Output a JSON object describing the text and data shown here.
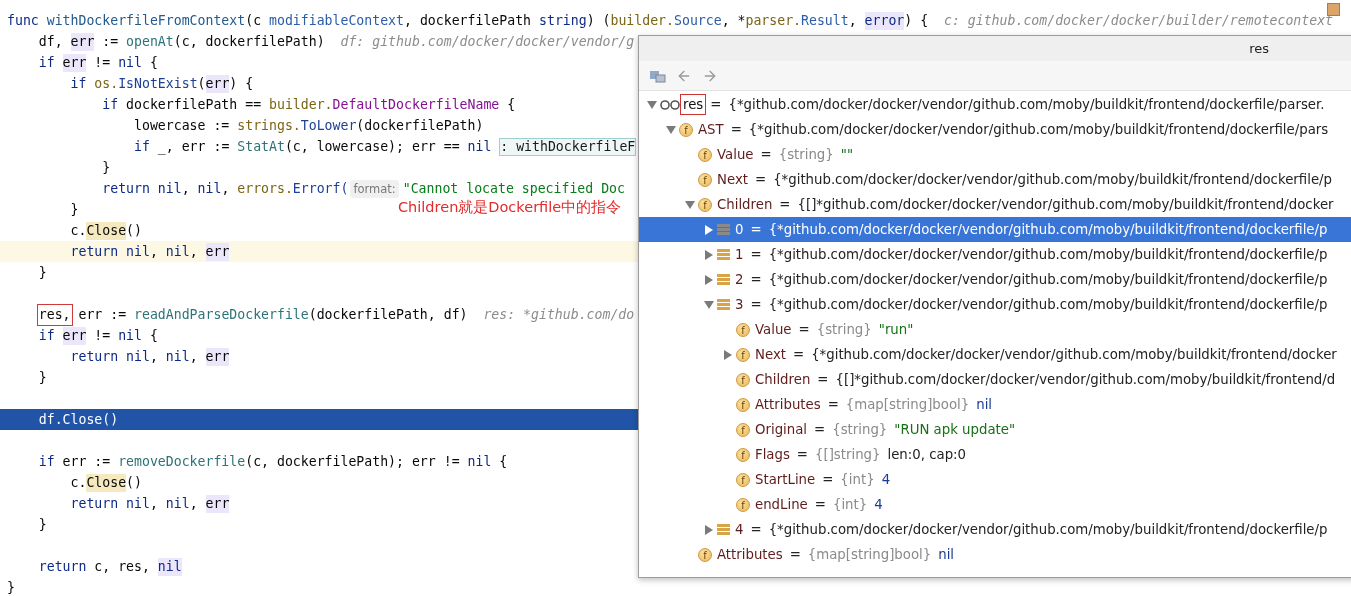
{
  "editor": {
    "lines": [
      {
        "selected": false,
        "caret": false,
        "tokens": [
          {
            "kind": "kw",
            "text": "func "
          },
          {
            "kind": "decl",
            "text": "withDockerfileFromContext"
          },
          {
            "kind": "plain",
            "text": "(c "
          },
          {
            "kind": "type",
            "text": "modifiableContext"
          },
          {
            "kind": "plain",
            "text": ", dockerfilePath "
          },
          {
            "kind": "kw",
            "text": "string"
          },
          {
            "kind": "plain",
            "text": ") ("
          },
          {
            "kind": "pkg",
            "text": "builder."
          },
          {
            "kind": "type",
            "text": "Source"
          },
          {
            "kind": "plain",
            "text": ", *"
          },
          {
            "kind": "pkg",
            "text": "parser."
          },
          {
            "kind": "type",
            "text": "Result"
          },
          {
            "kind": "plain",
            "text": ", "
          },
          {
            "kind": "refkw",
            "text": "error"
          },
          {
            "kind": "plain",
            "text": ") {"
          },
          {
            "kind": "hint",
            "text": "c: github.com/docker/docker/builder/remotecontext"
          }
        ]
      },
      {
        "selected": false,
        "caret": false,
        "tokens": [
          {
            "kind": "plain",
            "text": "    df, "
          },
          {
            "kind": "ref",
            "text": "err"
          },
          {
            "kind": "plain",
            "text": " := "
          },
          {
            "kind": "call",
            "text": "openAt"
          },
          {
            "kind": "plain",
            "text": "(c, dockerfilePath)"
          },
          {
            "kind": "hint",
            "text": "df: github.com/docker/docker/vendor/g"
          }
        ]
      },
      {
        "selected": false,
        "caret": false,
        "tokens": [
          {
            "kind": "kw",
            "text": "    if "
          },
          {
            "kind": "ref",
            "text": "err"
          },
          {
            "kind": "plain",
            "text": " != "
          },
          {
            "kind": "kw",
            "text": "nil"
          },
          {
            "kind": "plain",
            "text": " {"
          }
        ]
      },
      {
        "selected": false,
        "caret": false,
        "tokens": [
          {
            "kind": "kw",
            "text": "        if "
          },
          {
            "kind": "pkg",
            "text": "os."
          },
          {
            "kind": "method",
            "text": "IsNotExist"
          },
          {
            "kind": "plain",
            "text": "("
          },
          {
            "kind": "ref",
            "text": "err"
          },
          {
            "kind": "plain",
            "text": ") {"
          }
        ]
      },
      {
        "selected": false,
        "caret": false,
        "tokens": [
          {
            "kind": "kw",
            "text": "            if "
          },
          {
            "kind": "plain",
            "text": "dockerfilePath == "
          },
          {
            "kind": "pkg",
            "text": "builder."
          },
          {
            "kind": "const",
            "text": "DefaultDockerfileName"
          },
          {
            "kind": "plain",
            "text": " {"
          }
        ]
      },
      {
        "selected": false,
        "caret": false,
        "tokens": [
          {
            "kind": "plain",
            "text": "                lowercase := "
          },
          {
            "kind": "pkg",
            "text": "strings."
          },
          {
            "kind": "method",
            "text": "ToLower"
          },
          {
            "kind": "plain",
            "text": "(dockerfilePath)"
          }
        ]
      },
      {
        "selected": false,
        "caret": false,
        "tokens": [
          {
            "kind": "kw",
            "text": "                if "
          },
          {
            "kind": "plain",
            "text": "_, err := "
          },
          {
            "kind": "call",
            "text": "StatAt"
          },
          {
            "kind": "plain",
            "text": "(c, lowercase); err == "
          },
          {
            "kind": "kw",
            "text": "nil"
          },
          {
            "kind": "valuebox",
            "text": ": withDockerfileF"
          }
        ]
      },
      {
        "selected": false,
        "caret": false,
        "tokens": [
          {
            "kind": "plain",
            "text": "            }"
          }
        ]
      },
      {
        "selected": false,
        "caret": false,
        "tokens": [
          {
            "kind": "kw",
            "text": "            return "
          },
          {
            "kind": "kw",
            "text": "nil"
          },
          {
            "kind": "plain",
            "text": ", "
          },
          {
            "kind": "kw",
            "text": "nil"
          },
          {
            "kind": "plain",
            "text": ", "
          },
          {
            "kind": "pkg",
            "text": "errors."
          },
          {
            "kind": "method",
            "text": "Errorf("
          },
          {
            "kind": "inlay",
            "text": "format:"
          },
          {
            "kind": "str",
            "text": "\"Cannot locate specified Doc"
          }
        ]
      },
      {
        "selected": false,
        "caret": false,
        "tokens": [
          {
            "kind": "plain",
            "text": "        }"
          }
        ]
      },
      {
        "selected": false,
        "caret": false,
        "tokens": [
          {
            "kind": "plain",
            "text": "        c."
          },
          {
            "kind": "usage",
            "text": "Close"
          },
          {
            "kind": "plain",
            "text": "()"
          }
        ]
      },
      {
        "selected": false,
        "caret": true,
        "tokens": [
          {
            "kind": "kw",
            "text": "        return "
          },
          {
            "kind": "kw",
            "text": "nil"
          },
          {
            "kind": "plain",
            "text": ", "
          },
          {
            "kind": "kw",
            "text": "nil"
          },
          {
            "kind": "plain",
            "text": ", "
          },
          {
            "kind": "ref",
            "text": "err"
          }
        ]
      },
      {
        "selected": false,
        "caret": false,
        "tokens": [
          {
            "kind": "plain",
            "text": "    }"
          }
        ]
      },
      {
        "selected": false,
        "caret": false
      },
      {
        "selected": false,
        "caret": false,
        "tokens": [
          {
            "kind": "boxed",
            "text": "    res,"
          },
          {
            "kind": "plain",
            "text": " err := "
          },
          {
            "kind": "call",
            "text": "readAndParseDockerfile"
          },
          {
            "kind": "plain",
            "text": "(dockerfilePath, df)"
          },
          {
            "kind": "hint",
            "text": "res: *github.com/do"
          }
        ]
      },
      {
        "selected": false,
        "caret": false,
        "tokens": [
          {
            "kind": "kw",
            "text": "    if "
          },
          {
            "kind": "ref",
            "text": "err"
          },
          {
            "kind": "plain",
            "text": " != "
          },
          {
            "kind": "kw",
            "text": "nil"
          },
          {
            "kind": "plain",
            "text": " {"
          }
        ]
      },
      {
        "selected": false,
        "caret": false,
        "tokens": [
          {
            "kind": "kw",
            "text": "        return "
          },
          {
            "kind": "kw",
            "text": "nil"
          },
          {
            "kind": "plain",
            "text": ", "
          },
          {
            "kind": "kw",
            "text": "nil"
          },
          {
            "kind": "plain",
            "text": ", "
          },
          {
            "kind": "ref",
            "text": "err"
          }
        ]
      },
      {
        "selected": false,
        "caret": false,
        "tokens": [
          {
            "kind": "plain",
            "text": "    }"
          }
        ]
      },
      {
        "selected": false,
        "caret": false
      },
      {
        "selected": true,
        "caret": false,
        "tokens": [
          {
            "kind": "plain",
            "text": "    df.Close()"
          }
        ]
      },
      {
        "selected": false,
        "caret": false
      },
      {
        "selected": false,
        "caret": false,
        "tokens": [
          {
            "kind": "kw",
            "text": "    if "
          },
          {
            "kind": "plain",
            "text": "err := "
          },
          {
            "kind": "call",
            "text": "removeDockerfile"
          },
          {
            "kind": "plain",
            "text": "(c, dockerfilePath); err != "
          },
          {
            "kind": "kw",
            "text": "nil"
          },
          {
            "kind": "plain",
            "text": " {"
          }
        ]
      },
      {
        "selected": false,
        "caret": false,
        "tokens": [
          {
            "kind": "plain",
            "text": "        c."
          },
          {
            "kind": "usage",
            "text": "Close"
          },
          {
            "kind": "plain",
            "text": "()"
          }
        ]
      },
      {
        "selected": false,
        "caret": false,
        "tokens": [
          {
            "kind": "kw",
            "text": "        return "
          },
          {
            "kind": "kw",
            "text": "nil"
          },
          {
            "kind": "plain",
            "text": ", "
          },
          {
            "kind": "kw",
            "text": "nil"
          },
          {
            "kind": "plain",
            "text": ", "
          },
          {
            "kind": "ref",
            "text": "err"
          }
        ]
      },
      {
        "selected": false,
        "caret": false,
        "tokens": [
          {
            "kind": "plain",
            "text": "    }"
          }
        ]
      },
      {
        "selected": false,
        "caret": false
      },
      {
        "selected": false,
        "caret": false,
        "tokens": [
          {
            "kind": "kw",
            "text": "    return "
          },
          {
            "kind": "plain",
            "text": "c, res, "
          },
          {
            "kind": "refkw",
            "text": "nil"
          }
        ]
      },
      {
        "selected": false,
        "caret": false,
        "tokens": [
          {
            "kind": "plain",
            "text": "}"
          }
        ]
      }
    ]
  },
  "annotation": {
    "text": "Children就是Dockerfile中的指令"
  },
  "popup": {
    "title": "res",
    "tree": [
      {
        "kind": "watch",
        "name": "res",
        "boxed": true,
        "op": "=",
        "value": "{*github.com/docker/docker/vendor/github.com/moby/buildkit/frontend/dockerfile/parser.",
        "expanded": true,
        "selected": false,
        "children": [
          {
            "kind": "field",
            "badge": "f",
            "name": "AST",
            "op": "=",
            "value": "{*github.com/docker/docker/vendor/github.com/moby/buildkit/frontend/dockerfile/pars",
            "expanded": true,
            "selected": false,
            "children": [
              {
                "kind": "field",
                "badge": "f",
                "name": "Value",
                "op": "=",
                "type": "{string}",
                "string_value": "\"\"",
                "selected": false
              },
              {
                "kind": "field",
                "badge": "f",
                "name": "Next",
                "op": "=",
                "value": "{*github.com/docker/docker/vendor/github.com/moby/buildkit/frontend/dockerfile/p",
                "selected": false
              },
              {
                "kind": "field",
                "badge": "f",
                "name": "Children",
                "op": "=",
                "value": "{[]*github.com/docker/docker/vendor/github.com/moby/buildkit/frontend/docker",
                "expanded": true,
                "selected": false,
                "children": [
                  {
                    "kind": "element",
                    "name": "0",
                    "op": "=",
                    "value": "{*github.com/docker/docker/vendor/github.com/moby/buildkit/frontend/dockerfile/p",
                    "expanded": false,
                    "selected": true
                  },
                  {
                    "kind": "element",
                    "name": "1",
                    "op": "=",
                    "value": "{*github.com/docker/docker/vendor/github.com/moby/buildkit/frontend/dockerfile/p",
                    "expanded": false,
                    "selected": false
                  },
                  {
                    "kind": "element",
                    "name": "2",
                    "op": "=",
                    "value": "{*github.com/docker/docker/vendor/github.com/moby/buildkit/frontend/dockerfile/p",
                    "expanded": false,
                    "selected": false
                  },
                  {
                    "kind": "element",
                    "name": "3",
                    "op": "=",
                    "value": "{*github.com/docker/docker/vendor/github.com/moby/buildkit/frontend/dockerfile/p",
                    "expanded": true,
                    "selected": false,
                    "children": [
                      {
                        "kind": "field",
                        "badge": "f",
                        "name": "Value",
                        "op": "=",
                        "type": "{string}",
                        "string_value": "\"run\"",
                        "selected": false
                      },
                      {
                        "kind": "field",
                        "badge": "f",
                        "name": "Next",
                        "op": "=",
                        "value": "{*github.com/docker/docker/vendor/github.com/moby/buildkit/frontend/docker",
                        "expanded": false,
                        "selected": false
                      },
                      {
                        "kind": "field",
                        "badge": "f",
                        "name": "Children",
                        "op": "=",
                        "value": "{[]*github.com/docker/docker/vendor/github.com/moby/buildkit/frontend/d",
                        "selected": false
                      },
                      {
                        "kind": "field",
                        "badge": "f",
                        "name": "Attributes",
                        "op": "=",
                        "type": "{map[string]bool}",
                        "literal_value": "nil",
                        "selected": false
                      },
                      {
                        "kind": "field",
                        "badge": "f",
                        "name": "Original",
                        "op": "=",
                        "type": "{string}",
                        "string_value": "\"RUN apk update\"",
                        "selected": false
                      },
                      {
                        "kind": "field",
                        "badge": "f",
                        "name": "Flags",
                        "op": "=",
                        "type": "{[]string}",
                        "value": "len:0, cap:0",
                        "selected": false
                      },
                      {
                        "kind": "field",
                        "badge": "f",
                        "name": "StartLine",
                        "op": "=",
                        "type": "{int}",
                        "literal_value": "4",
                        "selected": false
                      },
                      {
                        "kind": "field",
                        "badge": "f",
                        "name": "endLine",
                        "op": "=",
                        "type": "{int}",
                        "literal_value": "4",
                        "selected": false
                      }
                    ]
                  },
                  {
                    "kind": "element",
                    "name": "4",
                    "op": "=",
                    "value": "{*github.com/docker/docker/vendor/github.com/moby/buildkit/frontend/dockerfile/p",
                    "expanded": false,
                    "selected": false
                  }
                ]
              },
              {
                "kind": "field",
                "badge": "f",
                "name": "Attributes",
                "op": "=",
                "type": "{map[string]bool}",
                "literal_value": "nil",
                "selected": false
              }
            ]
          }
        ]
      }
    ]
  }
}
